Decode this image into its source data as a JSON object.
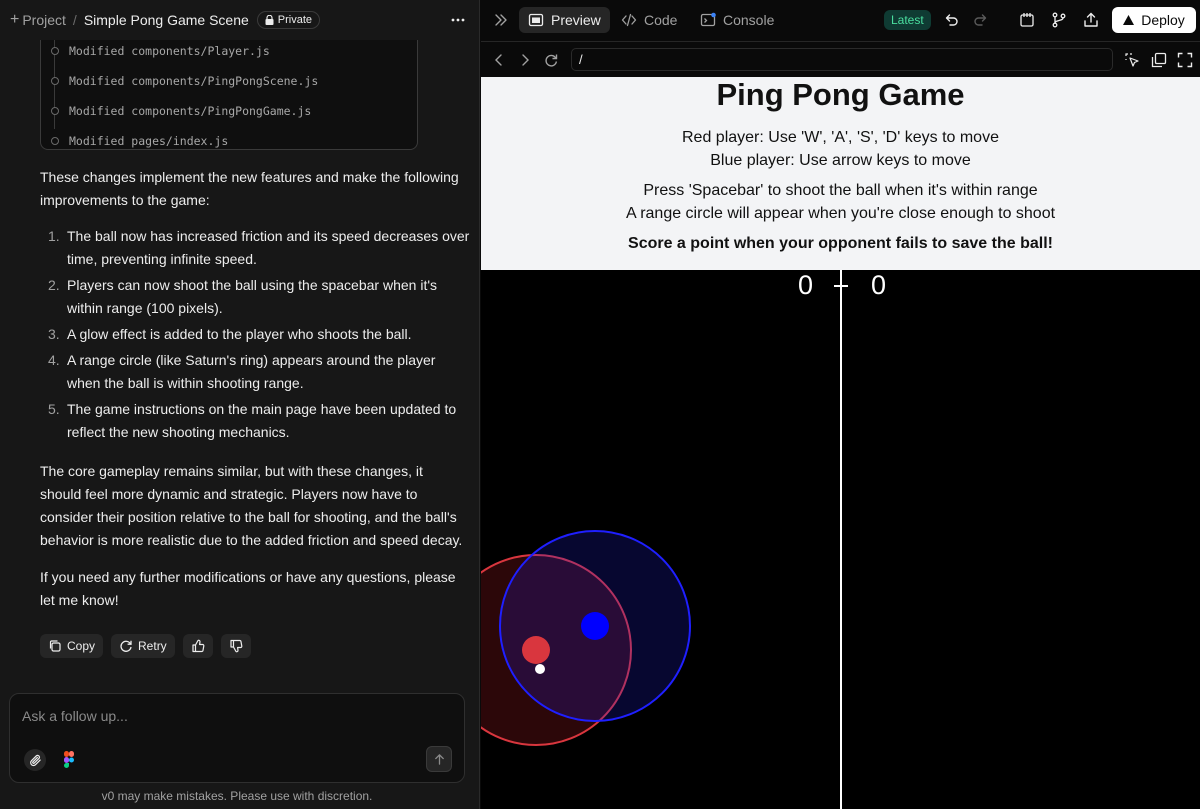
{
  "topbar": {
    "project_label": "Project",
    "separator": "/",
    "title": "Simple Pong Game Scene",
    "privacy_badge": "Private"
  },
  "chat": {
    "files": [
      "Modified components/Player.js",
      "Modified components/PingPongScene.js",
      "Modified components/PingPongGame.js",
      "Modified pages/index.js"
    ],
    "intro": "These changes implement the new features and make the following improvements to the game:",
    "steps": [
      "The ball now has increased friction and its speed decreases over time, preventing infinite speed.",
      "Players can now shoot the ball using the spacebar when it's within range (100 pixels).",
      "A glow effect is added to the player who shoots the ball.",
      "A range circle (like Saturn's ring) appears around the player when the ball is within shooting range.",
      "The game instructions on the main page have been updated to reflect the new shooting mechanics."
    ],
    "summary": "The core gameplay remains similar, but with these changes, it should feel more dynamic and strategic. Players now have to consider their position relative to the ball for shooting, and the ball's behavior is more realistic due to the added friction and speed decay.",
    "closing": "If you need any further modifications or have any questions, please let me know!",
    "actions": {
      "copy": "Copy",
      "retry": "Retry"
    }
  },
  "composer": {
    "placeholder": "Ask a follow up...",
    "disclaimer": "v0 may make mistakes. Please use with discretion."
  },
  "right_toolbar": {
    "tabs": [
      "Preview",
      "Code",
      "Console"
    ],
    "active_tab": "Preview",
    "version_badge": "Latest",
    "deploy_label": "Deploy"
  },
  "url_bar": {
    "path": "/"
  },
  "game": {
    "title": "Ping Pong Game",
    "instructions": [
      "Red player: Use 'W', 'A', 'S', 'D' keys to move",
      "Blue player: Use arrow keys to move",
      "Press 'Spacebar' to shoot the ball when it's within range",
      "A range circle will appear when you're close enough to shoot",
      "Score a point when your opponent fails to save the ball!"
    ],
    "score_red": "0",
    "score_blue": "0",
    "colors": {
      "red_player": "#d9363e",
      "blue_player": "#0000ff",
      "ball": "#ffffff",
      "court": "#000000"
    }
  }
}
